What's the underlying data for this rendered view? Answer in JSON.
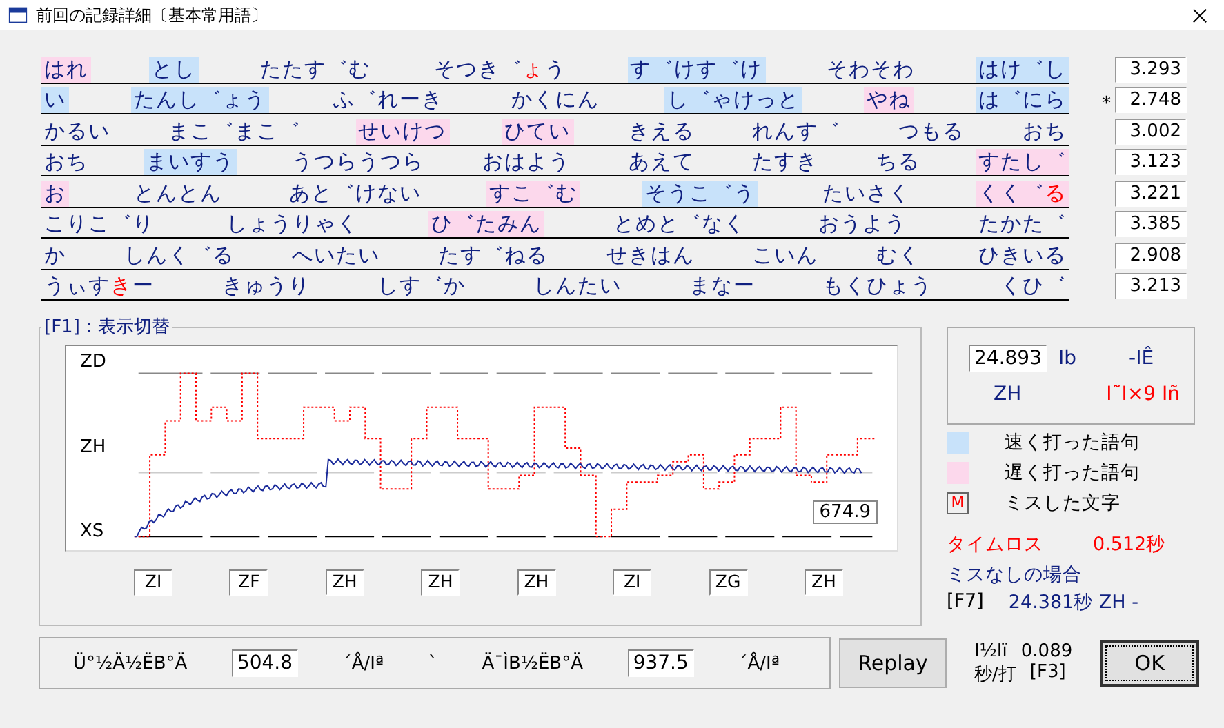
{
  "window": {
    "title": "前回の記録詳細〔基本常用語〕"
  },
  "word_rows": [
    {
      "score": "3.293",
      "marker": "",
      "words": [
        {
          "text": "はれ",
          "fast": false,
          "slow": true
        },
        {
          "text": "とし",
          "fast": true,
          "slow": false
        },
        {
          "text": "たたす゛む",
          "fast": false,
          "slow": false
        },
        {
          "fast": false,
          "slow": false,
          "parts": [
            {
              "text": "そつき゛",
              "miss": false
            },
            {
              "text": "ょ",
              "miss": true
            },
            {
              "text": "う",
              "miss": false
            }
          ]
        },
        {
          "text": "す゛けす゛け",
          "fast": true,
          "slow": false
        },
        {
          "text": "そわそわ",
          "fast": false,
          "slow": false
        },
        {
          "text": "はけ゛し",
          "fast": true,
          "slow": false
        }
      ]
    },
    {
      "score": "2.748",
      "marker": "*",
      "words": [
        {
          "text": "い",
          "fast": true,
          "slow": false
        },
        {
          "text": "たんし゛ょう",
          "fast": true,
          "slow": false
        },
        {
          "text": "ふ゛れーき",
          "fast": false,
          "slow": false
        },
        {
          "text": "かくにん",
          "fast": false,
          "slow": false
        },
        {
          "text": "し゛ゃけっと",
          "fast": true,
          "slow": false
        },
        {
          "text": "やね",
          "fast": false,
          "slow": true
        },
        {
          "text": "は゛にら",
          "fast": true,
          "slow": false
        }
      ]
    },
    {
      "score": "3.002",
      "marker": "",
      "words": [
        {
          "text": "かるい",
          "fast": false,
          "slow": false
        },
        {
          "text": "まこ゛まこ゛",
          "fast": false,
          "slow": false
        },
        {
          "text": "せいけつ",
          "fast": false,
          "slow": true
        },
        {
          "text": "ひてい",
          "fast": false,
          "slow": true
        },
        {
          "text": "きえる",
          "fast": false,
          "slow": false
        },
        {
          "text": "れんす゛",
          "fast": false,
          "slow": false
        },
        {
          "text": "つもる",
          "fast": false,
          "slow": false
        },
        {
          "text": "おち",
          "fast": false,
          "slow": false
        }
      ]
    },
    {
      "score": "3.123",
      "marker": "",
      "words": [
        {
          "text": "おち",
          "fast": false,
          "slow": false
        },
        {
          "text": "まいすう",
          "fast": true,
          "slow": false
        },
        {
          "text": "うつらうつら",
          "fast": false,
          "slow": false
        },
        {
          "text": "おはよう",
          "fast": false,
          "slow": false
        },
        {
          "text": "あえて",
          "fast": false,
          "slow": false
        },
        {
          "text": "たすき",
          "fast": false,
          "slow": false
        },
        {
          "text": "ちる",
          "fast": false,
          "slow": false
        },
        {
          "text": "すたし゛",
          "fast": false,
          "slow": true
        }
      ]
    },
    {
      "score": "3.221",
      "marker": "",
      "words": [
        {
          "text": "お",
          "fast": false,
          "slow": true
        },
        {
          "text": "とんとん",
          "fast": false,
          "slow": false
        },
        {
          "text": "あと゛けない",
          "fast": false,
          "slow": false
        },
        {
          "text": "すこ゛む",
          "fast": false,
          "slow": true
        },
        {
          "text": "そうこ゛う",
          "fast": true,
          "slow": false
        },
        {
          "text": "たいさく",
          "fast": false,
          "slow": false
        },
        {
          "fast": false,
          "slow": true,
          "parts": [
            {
              "text": "くく゛",
              "miss": false
            },
            {
              "text": "る",
              "miss": true
            }
          ]
        }
      ]
    },
    {
      "score": "3.385",
      "marker": "",
      "words": [
        {
          "text": "こりこ゛り",
          "fast": false,
          "slow": false
        },
        {
          "text": "しょうりゃく",
          "fast": false,
          "slow": false
        },
        {
          "text": "ひ゛たみん",
          "fast": false,
          "slow": true
        },
        {
          "text": "とめと゛なく",
          "fast": false,
          "slow": false
        },
        {
          "text": "おうよう",
          "fast": false,
          "slow": false
        },
        {
          "text": "たかた゛",
          "fast": false,
          "slow": false
        }
      ]
    },
    {
      "score": "2.908",
      "marker": "",
      "words": [
        {
          "text": "か",
          "fast": false,
          "slow": false
        },
        {
          "text": "しんく゛る",
          "fast": false,
          "slow": false
        },
        {
          "text": "へいたい",
          "fast": false,
          "slow": false
        },
        {
          "text": "たす゛ねる",
          "fast": false,
          "slow": false
        },
        {
          "text": "せきはん",
          "fast": false,
          "slow": false
        },
        {
          "text": "こいん",
          "fast": false,
          "slow": false
        },
        {
          "text": "むく",
          "fast": false,
          "slow": false
        },
        {
          "text": "ひきいる",
          "fast": false,
          "slow": false
        }
      ]
    },
    {
      "score": "3.213",
      "marker": "",
      "words": [
        {
          "fast": false,
          "slow": false,
          "parts": [
            {
              "text": "うぃす",
              "miss": false
            },
            {
              "text": "き",
              "miss": true
            },
            {
              "text": "ー",
              "miss": false
            }
          ]
        },
        {
          "text": "きゅうり",
          "fast": false,
          "slow": false
        },
        {
          "text": "しす゛か",
          "fast": false,
          "slow": false
        },
        {
          "text": "しんたい",
          "fast": false,
          "slow": false
        },
        {
          "text": "まなー",
          "fast": false,
          "slow": false
        },
        {
          "text": "もくひょう",
          "fast": false,
          "slow": false
        },
        {
          "text": "くひ゛",
          "fast": false,
          "slow": false
        }
      ]
    }
  ],
  "graph": {
    "legend": "[F1]：表示切替",
    "y_labels": [
      "ZD",
      "ZH",
      "XS"
    ],
    "value": "674.9",
    "segments": [
      "ZI",
      "ZF",
      "ZH",
      "ZH",
      "ZH",
      "ZI",
      "ZG",
      "ZH"
    ]
  },
  "summary": {
    "field": "24.893",
    "unit": "Ib",
    "suffix": "-IÊ",
    "rank": "ZH",
    "mojibake": "I˜I×9 Iñ"
  },
  "legend": [
    {
      "kind": "fast",
      "label": "速く打った語句"
    },
    {
      "kind": "slow",
      "label": "遅く打った語句"
    },
    {
      "kind": "miss",
      "mark": "M",
      "label": "ミスした文字"
    }
  ],
  "time_loss": {
    "label": "タイムロス",
    "value": "0.512秒"
  },
  "no_miss": {
    "label": "ミスなしの場合",
    "key": "[F7]",
    "value": "24.381秒 ZH -"
  },
  "speeds": {
    "label_1": "Ü°½Ä½ËB°Ä",
    "value_1": "504.8",
    "unit_1": "´Å/Iª",
    "separator": "`",
    "label_2": "Ä¯ÌB½ËB°Ä",
    "value_2": "937.5",
    "unit_2": "´Å/Iª"
  },
  "replay_button": "Replay",
  "per_key": {
    "label": "I½Iï",
    "value": "0.089",
    "unit": "秒/打",
    "key": "[F3]"
  },
  "ok_button": "OK"
}
